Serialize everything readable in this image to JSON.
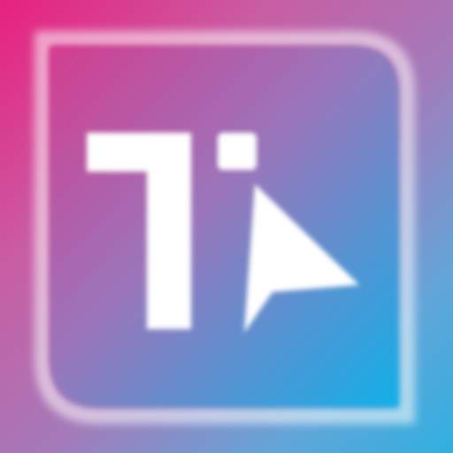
{
  "app": {
    "icon_name": "app-logo-icon",
    "glyph_icon": "letter-t-icon",
    "cursor_icon": "cursor-arrow-icon"
  },
  "colors": {
    "gradient_start": "#e8207e",
    "gradient_mid": "#a47ab9",
    "gradient_end": "#2fb0e0",
    "tile_start": "#d43d8f",
    "tile_end": "#12b0e8",
    "foreground": "#ffffff"
  }
}
